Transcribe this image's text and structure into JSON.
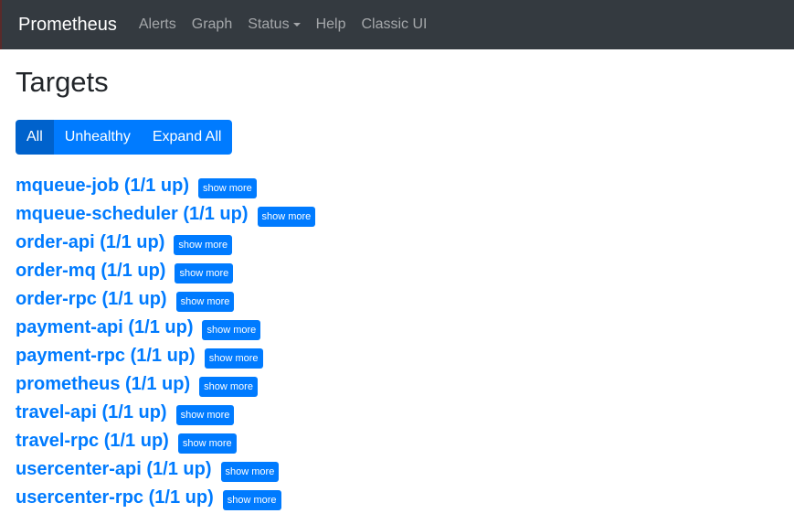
{
  "navbar": {
    "brand": "Prometheus",
    "items": [
      {
        "label": "Alerts"
      },
      {
        "label": "Graph"
      },
      {
        "label": "Status"
      },
      {
        "label": "Help"
      },
      {
        "label": "Classic UI"
      }
    ]
  },
  "page": {
    "title": "Targets",
    "filters": [
      {
        "label": "All",
        "active": true
      },
      {
        "label": "Unhealthy",
        "active": false
      },
      {
        "label": "Expand All",
        "active": false
      }
    ],
    "show_more_label": "show more",
    "targets": [
      {
        "name": "mqueue-job (1/1 up)"
      },
      {
        "name": "mqueue-scheduler (1/1 up)"
      },
      {
        "name": "order-api (1/1 up)"
      },
      {
        "name": "order-mq (1/1 up)"
      },
      {
        "name": "order-rpc (1/1 up)"
      },
      {
        "name": "payment-api (1/1 up)"
      },
      {
        "name": "payment-rpc (1/1 up)"
      },
      {
        "name": "prometheus (1/1 up)"
      },
      {
        "name": "travel-api (1/1 up)"
      },
      {
        "name": "travel-rpc (1/1 up)"
      },
      {
        "name": "usercenter-api (1/1 up)"
      },
      {
        "name": "usercenter-rpc (1/1 up)"
      }
    ]
  },
  "colors": {
    "navbar_bg": "#343a40",
    "primary": "#007bff",
    "active_button": "#0062cc"
  }
}
